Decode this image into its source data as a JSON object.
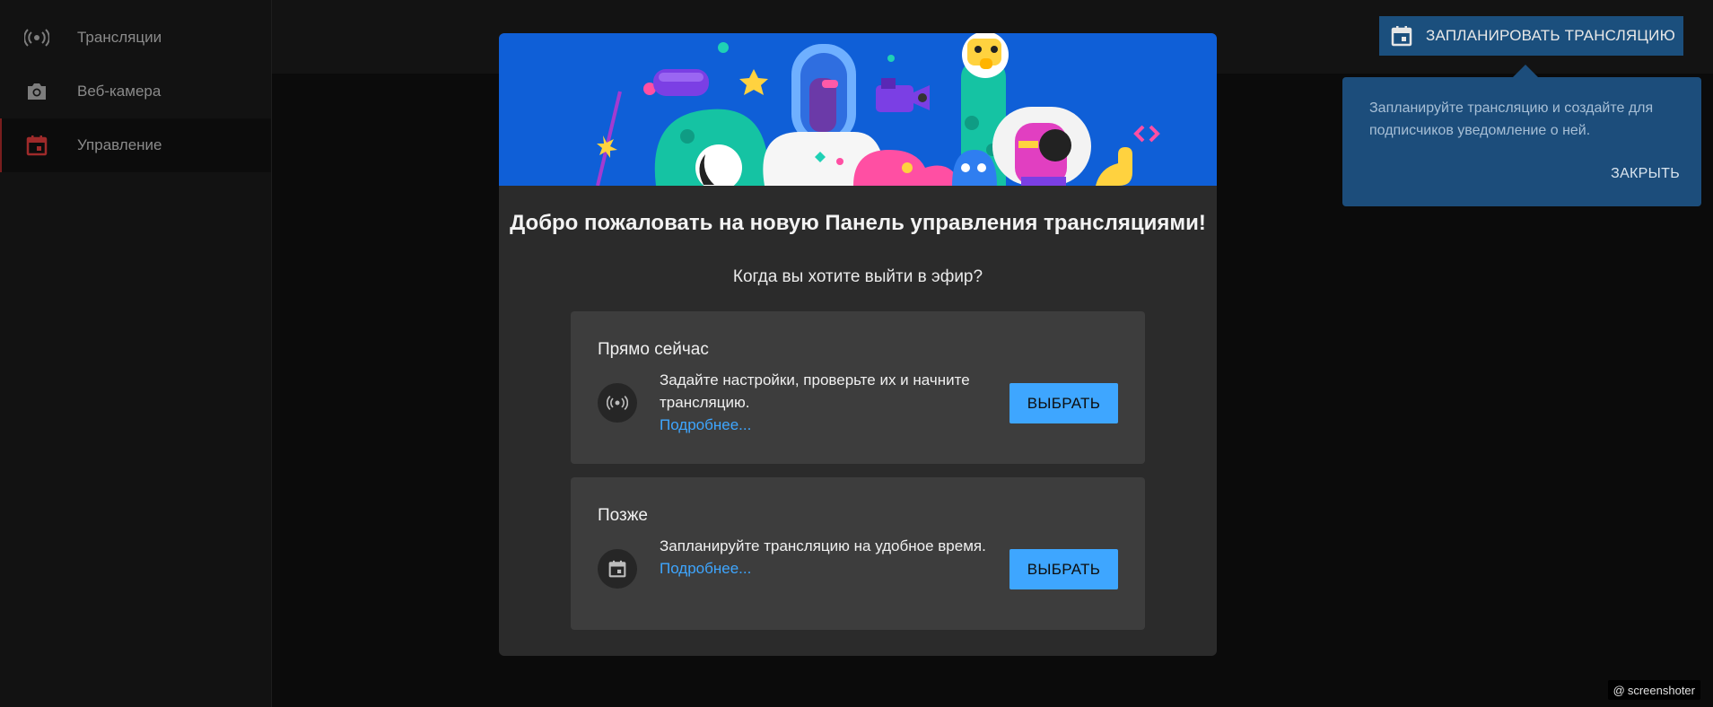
{
  "sidebar": {
    "items": [
      {
        "label": "Трансляции",
        "icon": "broadcast-icon"
      },
      {
        "label": "Веб-камера",
        "icon": "camera-icon"
      },
      {
        "label": "Управление",
        "icon": "calendar-icon",
        "active": true
      }
    ]
  },
  "header": {
    "schedule_button": "ЗАПЛАНИРОВАТЬ ТРАНСЛЯЦИЮ"
  },
  "tooltip": {
    "text": "Запланируйте трансляцию и создайте для подписчиков уведомление о ней.",
    "close_label": "ЗАКРЫТЬ"
  },
  "modal": {
    "title": "Добро пожаловать на новую Панель управления трансляциями!",
    "subtitle": "Когда вы хотите выйти в эфир?",
    "options": [
      {
        "title": "Прямо сейчас",
        "description": "Задайте настройки, проверьте их и начните трансляцию.",
        "link": "Подробнее...",
        "button": "ВЫБРАТЬ",
        "icon": "broadcast-icon"
      },
      {
        "title": "Позже",
        "description": "Запланируйте трансляцию на удобное время.",
        "link": "Подробнее...",
        "button": "ВЫБРАТЬ",
        "icon": "calendar-icon"
      }
    ]
  },
  "watermark": "screenshoter",
  "colors": {
    "accent": "#3ea6ff",
    "tooltip_bg": "#1c4d7b",
    "hero_bg": "#0f5fd7",
    "active_icon": "#9e2a2a"
  }
}
